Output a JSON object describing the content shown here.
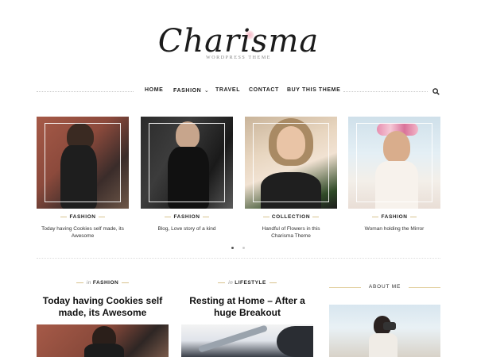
{
  "site": {
    "logo_text": "Charisma",
    "tagline": "WORDPRESS THEME"
  },
  "nav": {
    "items": [
      "HOME",
      "FASHION",
      "TRAVEL",
      "CONTACT",
      "BUY THIS THEME"
    ],
    "dropdown_caret": "⌄"
  },
  "slider": {
    "slides": [
      {
        "category": "FASHION",
        "title": "Today having Cookies self made, its Awesome"
      },
      {
        "category": "FASHION",
        "title": "Blog, Love story of a kind"
      },
      {
        "category": "COLLECTION",
        "title": "Handful of Flowers in this Charisma Theme"
      },
      {
        "category": "FASHION",
        "title": "Woman holding the Mirror"
      }
    ],
    "active_dot": 1,
    "dots_total": 2
  },
  "posts": [
    {
      "in_label": "in",
      "category": "FASHION",
      "title": "Today having Cookies self made, its Awesome"
    },
    {
      "in_label": "in",
      "category": "LIFESTYLE",
      "title": "Resting at Home – After a huge Breakout"
    }
  ],
  "sidebar": {
    "about_title": "ABOUT ME"
  },
  "colors": {
    "accent_gold": "#d8c38e",
    "text_dark": "#222222",
    "dot_active": "#555555",
    "dot_inactive": "#cccccc"
  }
}
